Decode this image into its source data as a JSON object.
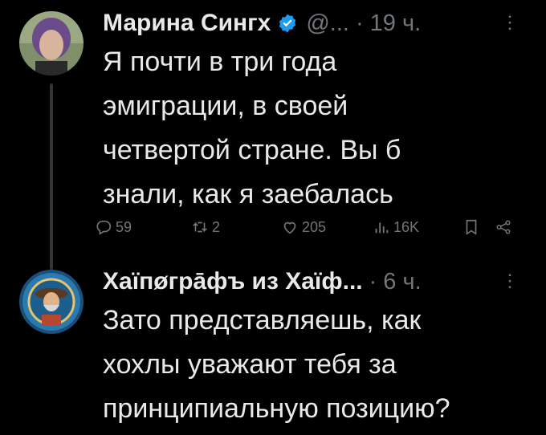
{
  "tweet1": {
    "author_name": "Марина Сингх",
    "handle": "@...",
    "time": "19 ч.",
    "text_lines": [
      "Я почти в три года",
      "эмиграции, в своей",
      "четвертой стране. Вы б",
      "знали, как я заебалась"
    ],
    "replies": "59",
    "retweets": "2",
    "likes": "205",
    "views": "16K"
  },
  "tweet2": {
    "author_name": "Хаїпøгрāфъ из Хаїф...",
    "time": "6 ч.",
    "text_lines": [
      "Зато представляешь, как",
      "хохлы уважают тебя за",
      "принципиальную позицию?"
    ]
  },
  "colors": {
    "verified": "#1d9bf0",
    "muted": "#71767b",
    "text": "#e7e9ea"
  },
  "icons": [
    "verified-badge-icon",
    "more-icon",
    "reply-icon",
    "retweet-icon",
    "like-icon",
    "views-icon",
    "bookmark-icon",
    "share-icon"
  ]
}
